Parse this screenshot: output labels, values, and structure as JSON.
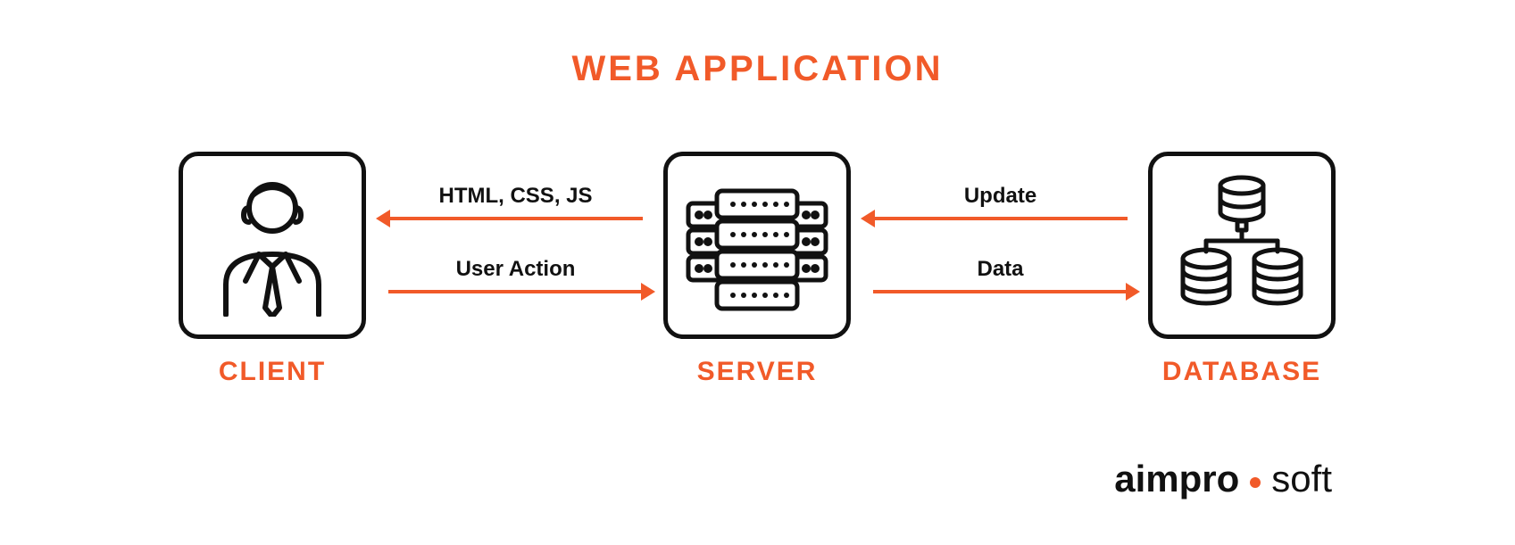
{
  "title": "WEB APPLICATION",
  "nodes": {
    "client": {
      "label": "CLIENT"
    },
    "server": {
      "label": "SERVER"
    },
    "database": {
      "label": "DATABASE"
    }
  },
  "arrows": {
    "server_to_client": {
      "label": "HTML, CSS, JS"
    },
    "client_to_server": {
      "label": "User Action"
    },
    "database_to_server": {
      "label": "Update"
    },
    "server_to_database": {
      "label": "Data"
    }
  },
  "brand": {
    "part1": "aimpro",
    "part2": "soft"
  },
  "colors": {
    "accent": "#f15a29",
    "ink": "#111111"
  }
}
